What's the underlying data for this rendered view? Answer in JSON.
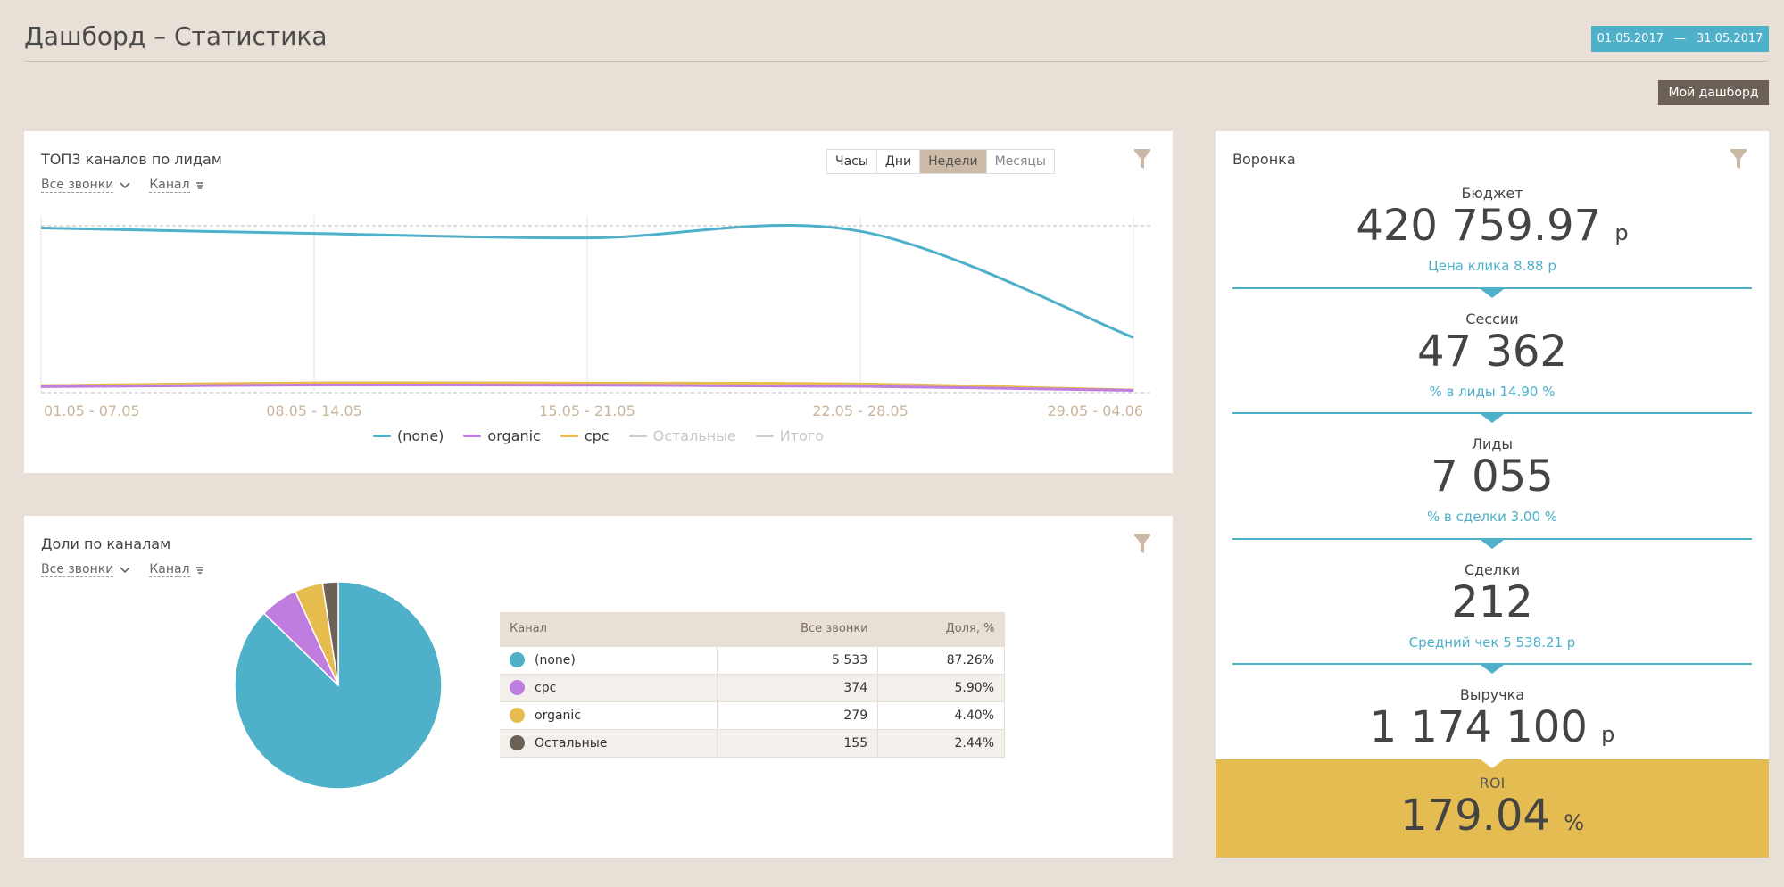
{
  "header": {
    "title": "Дашборд – Статистика",
    "date_from": "01.05.2017",
    "date_sep": "—",
    "date_to": "31.05.2017",
    "my_dashboard": "Мой дашборд"
  },
  "top3": {
    "title": "ТОП3 каналов по лидам",
    "filter_calls": "Все звонки",
    "filter_channel": "Канал",
    "periods": [
      "Часы",
      "Дни",
      "Недели",
      "Месяцы"
    ],
    "active_period": "Недели"
  },
  "chart_data": {
    "type": "line",
    "title": "ТОП3 каналов по лидам",
    "categories": [
      "01.05 - 07.05",
      "08.05 - 14.05",
      "15.05 - 21.05",
      "22.05 - 28.05",
      "29.05 - 04.06"
    ],
    "ylim": [
      0,
      1500
    ],
    "series": [
      {
        "name": "(none)",
        "color": "#4eb0c9",
        "values": [
          1480,
          1430,
          1390,
          1450,
          490
        ],
        "enabled": true
      },
      {
        "name": "organic",
        "color": "#c07de0",
        "values": [
          45,
          60,
          58,
          48,
          12
        ],
        "enabled": true
      },
      {
        "name": "cpc",
        "color": "#e6bc4f",
        "values": [
          55,
          80,
          78,
          70,
          15
        ],
        "enabled": true
      },
      {
        "name": "Остальные",
        "color": "#cccccc",
        "values": [],
        "enabled": false
      },
      {
        "name": "Итого",
        "color": "#cccccc",
        "values": [],
        "enabled": false
      }
    ],
    "grid": true,
    "legend": "bottom"
  },
  "shares": {
    "title": "Доли по каналам",
    "filter_calls": "Все звонки",
    "filter_channel": "Канал",
    "table_headers": [
      "Канал",
      "Все звонки",
      "Доля, %"
    ],
    "rows": [
      {
        "channel": "(none)",
        "calls": "5 533",
        "share": "87.26%",
        "color": "#4eb0c9",
        "value": 87.26
      },
      {
        "channel": "cpc",
        "calls": "374",
        "share": "5.90%",
        "color": "#c07de0",
        "value": 5.9
      },
      {
        "channel": "organic",
        "calls": "279",
        "share": "4.40%",
        "color": "#e6bc4f",
        "value": 4.4
      },
      {
        "channel": "Остальные",
        "calls": "155",
        "share": "2.44%",
        "color": "#6b6157",
        "value": 2.44
      }
    ]
  },
  "funnel": {
    "title": "Воронка",
    "stages": [
      {
        "label": "Бюджет",
        "value": "420 759.97",
        "unit": "р",
        "sub": "Цена клика 8.88 р"
      },
      {
        "label": "Сессии",
        "value": "47 362",
        "unit": "",
        "sub": "% в лиды 14.90 %"
      },
      {
        "label": "Лиды",
        "value": "7 055",
        "unit": "",
        "sub": "% в сделки 3.00 %"
      },
      {
        "label": "Сделки",
        "value": "212",
        "unit": "",
        "sub": "Средний чек 5 538.21 р"
      },
      {
        "label": "Выручка",
        "value": "1 174 100",
        "unit": "р",
        "sub": ""
      }
    ],
    "roi_label": "ROI",
    "roi_value": "179.04",
    "roi_unit": "%"
  },
  "colors": {
    "accent": "#4eb0c9",
    "background": "#e8e0d6",
    "roi": "#e5bc52"
  }
}
